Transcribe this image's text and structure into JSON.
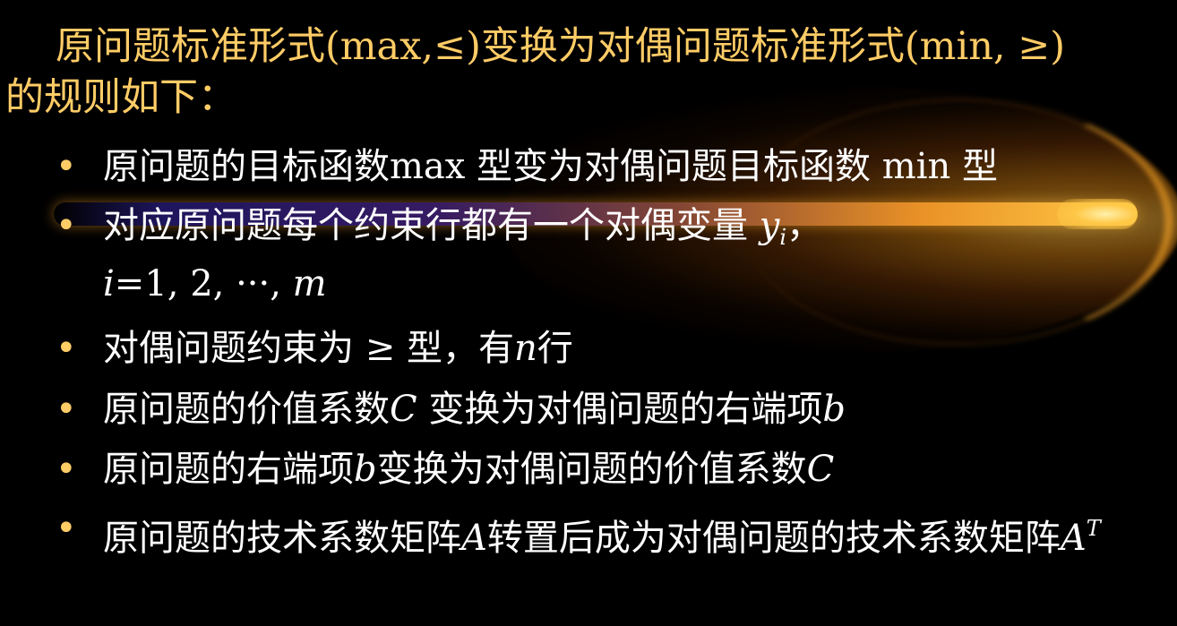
{
  "heading": {
    "line1": "原问题标准形式(max,≤)变换为对偶问题标准形式(min, ≥)",
    "line2": "的规则如下："
  },
  "bullet_marker": "•",
  "bullets": [
    {
      "text": "原问题的目标函数max 型变为对偶问题目标函数 min 型"
    },
    {
      "prefix": "对应原问题每个约束行都有一个对偶变量 ",
      "var": "y",
      "sub": "i",
      "suffix": "，",
      "line2_var1": "i",
      "line2_mid": "=1, 2, ···, ",
      "line2_var2": "m"
    },
    {
      "prefix": "对偶问题约束为 ≥ 型，有",
      "var": "n",
      "suffix": "行"
    },
    {
      "prefix": "原问题的价值系数",
      "var1": "C",
      "mid": " 变换为对偶问题的右端项",
      "var2": "b"
    },
    {
      "prefix": "原问题的右端项",
      "var1": "b",
      "mid": "变换为对偶问题的价值系数",
      "var2": "C"
    },
    {
      "prefix": "原问题的技术系数矩阵",
      "var1": "A",
      "mid": "转置后成为对偶问题的技术系数矩阵",
      "var2": "A",
      "sup": "T"
    }
  ],
  "colors": {
    "background": "#000000",
    "heading": "#FFCC66",
    "bullet_text": "#FFFFFF",
    "bullet_marker": "#FFCC66",
    "flare": "#FFB030"
  }
}
